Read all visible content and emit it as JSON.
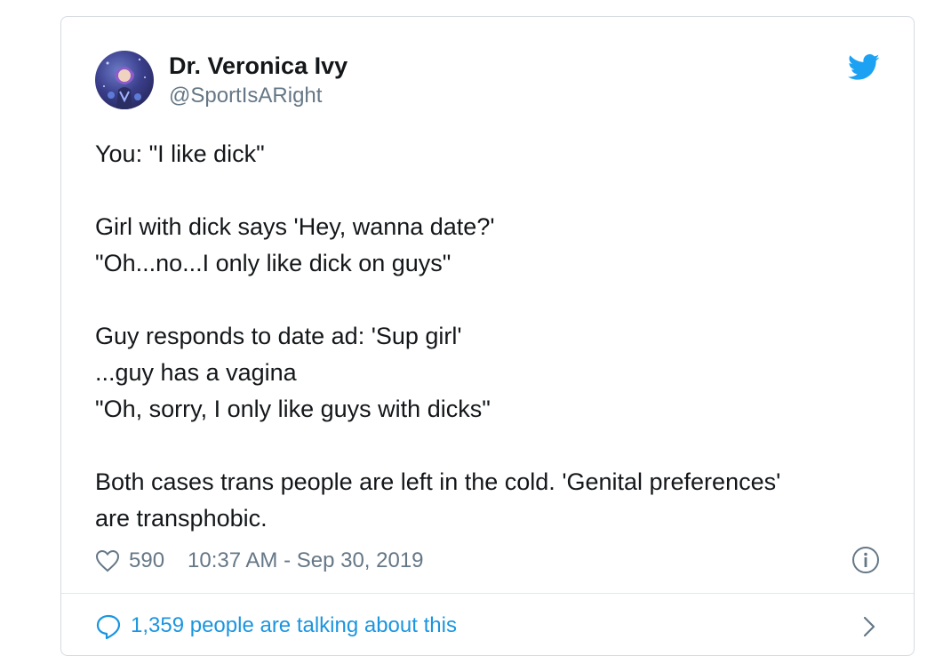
{
  "author": {
    "name": "Dr. Veronica Ivy",
    "handle": "@SportIsARight"
  },
  "tweet": {
    "paragraphs": [
      "You: \"I like dick\"",
      "Girl with dick says 'Hey, wanna date?'\n\"Oh...no...I only like dick on guys\"",
      "Guy responds to date ad: 'Sup girl'\n...guy has a vagina\n\"Oh, sorry, I only like guys with dicks\"",
      "Both cases trans people are left in the cold. 'Genital preferences'\nare transphobic."
    ]
  },
  "meta": {
    "likes": "590",
    "timestamp": "10:37 AM - Sep 30, 2019"
  },
  "footer": {
    "talking": "1,359 people are talking about this"
  },
  "colors": {
    "brand_blue": "#1da1f2",
    "link_blue": "#1b95e0",
    "muted_gray": "#657786",
    "text": "#14171a",
    "border": "#d4dbe0"
  },
  "icons": [
    "twitter-bird-icon",
    "heart-icon",
    "info-icon",
    "reply-bubble-icon",
    "chevron-right-icon"
  ]
}
